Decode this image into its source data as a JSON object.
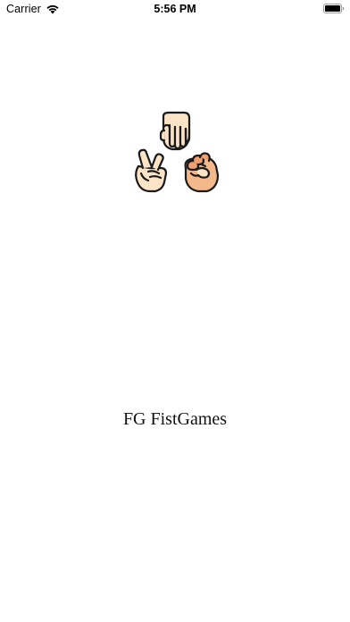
{
  "status_bar": {
    "carrier": "Carrier",
    "time": "5:56 PM",
    "icons": [
      "wifi-icon",
      "battery-icon"
    ]
  },
  "splash": {
    "logo_icon": "rock-paper-scissors-hands-icon",
    "title": "FG FistGames"
  },
  "colors": {
    "background": "#ffffff",
    "skin_light": "#fbe3c6",
    "skin_mid": "#f4b98a",
    "skin_dark": "#f0a070",
    "outline": "#1a1a1a"
  }
}
